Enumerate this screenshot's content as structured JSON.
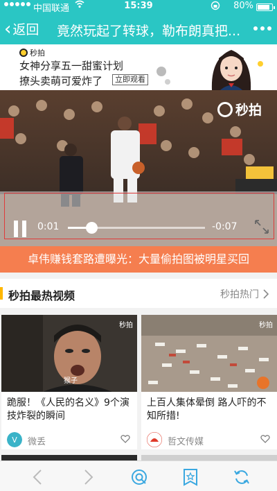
{
  "status_bar": {
    "carrier": "中国联通",
    "time": "15:39",
    "battery": "80%"
  },
  "nav": {
    "back_label": "返回",
    "title": "竟然玩起了转球，勒布朗真把..."
  },
  "ad": {
    "brand": "秒拍",
    "line1": "女神分享五一甜蜜计划",
    "line2": "撩头卖萌可爱炸了",
    "cta": "立即观看"
  },
  "video": {
    "watermark": "秒拍",
    "current_time": "0:01",
    "remaining_time": "-0:07",
    "progress_fraction": 0.17
  },
  "banner": {
    "text": "卓伟赚钱套路遭曝光：大量偷拍图被明星买回"
  },
  "section": {
    "title": "秒拍最热视频",
    "more_label": "秒拍热门"
  },
  "cards": [
    {
      "title": "跪服！《人民的名义》9个演技炸裂的瞬间",
      "author": "微丢",
      "watermark": "秒拍",
      "caption": "猴子"
    },
    {
      "title": "上百人集体晕倒 路人吓的不知所措!",
      "author": "哲文传媒",
      "watermark": "秒拍"
    }
  ],
  "colors": {
    "header": "#2ac6c4",
    "banner": "#f57e4f",
    "accent": "#ffb700",
    "toolbar_icon": "#3aa8e0"
  }
}
